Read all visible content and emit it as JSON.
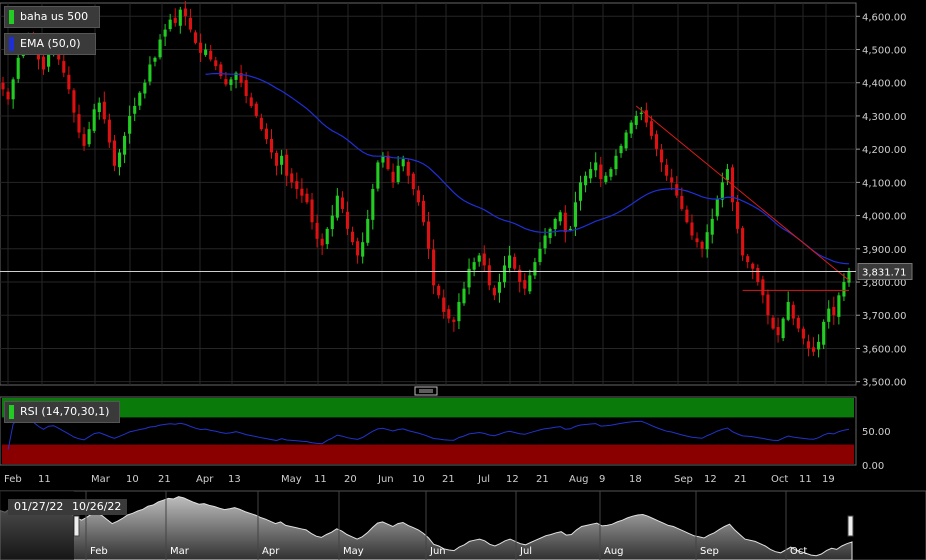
{
  "chart_data": {
    "type": "candlestick",
    "instrument": "baha us 500",
    "indicator": "EMA (50,0)",
    "last_price": "3,831.71",
    "y_ticks": [
      "4,600.00",
      "4,500.00",
      "4,400.00",
      "4,300.00",
      "4,200.00",
      "4,100.00",
      "4,000.00",
      "3,900.00",
      "3,800.00",
      "3,700.00",
      "3,600.00",
      "3,500.00"
    ],
    "ylim": [
      3490,
      4640
    ],
    "x_ticks": [
      "Feb",
      "11",
      "Mar",
      "10",
      "21",
      "Apr",
      "13",
      "May",
      "11",
      "20",
      "Jun",
      "10",
      "21",
      "Jul",
      "12",
      "21",
      "Aug",
      "9",
      "18",
      "Sep",
      "12",
      "21",
      "Oct",
      "11",
      "19"
    ],
    "closes": [
      4380,
      4350,
      4410,
      4475,
      4520,
      4540,
      4505,
      4470,
      4440,
      4490,
      4500,
      4470,
      4430,
      4380,
      4310,
      4250,
      4210,
      4260,
      4320,
      4340,
      4290,
      4220,
      4150,
      4190,
      4240,
      4300,
      4330,
      4370,
      4400,
      4455,
      4475,
      4530,
      4560,
      4590,
      4580,
      4620,
      4600,
      4560,
      4520,
      4490,
      4500,
      4470,
      4450,
      4420,
      4395,
      4410,
      4430,
      4400,
      4360,
      4330,
      4300,
      4260,
      4230,
      4190,
      4150,
      4180,
      4120,
      4100,
      4080,
      4060,
      4040,
      3980,
      3930,
      3910,
      3960,
      4000,
      4060,
      4020,
      3960,
      3920,
      3880,
      3920,
      3990,
      4080,
      4160,
      4180,
      4140,
      4100,
      4150,
      4170,
      4120,
      4080,
      4040,
      3980,
      3900,
      3790,
      3760,
      3710,
      3690,
      3680,
      3740,
      3780,
      3840,
      3860,
      3880,
      3850,
      3790,
      3760,
      3800,
      3850,
      3880,
      3840,
      3800,
      3780,
      3820,
      3860,
      3900,
      3940,
      3960,
      3990,
      4010,
      3950,
      3960,
      4040,
      4100,
      4120,
      4140,
      4160,
      4110,
      4120,
      4140,
      4180,
      4210,
      4250,
      4280,
      4300,
      4310,
      4280,
      4240,
      4200,
      4160,
      4120,
      4100,
      4060,
      4020,
      3980,
      3940,
      3920,
      3900,
      3950,
      3990,
      4050,
      4100,
      4140,
      4040,
      3960,
      3880,
      3860,
      3840,
      3800,
      3760,
      3700,
      3660,
      3640,
      3690,
      3740,
      3690,
      3660,
      3630,
      3600,
      3590,
      3620,
      3680,
      3720,
      3700,
      3760,
      3800,
      3831.71
    ],
    "ema_range": [
      4460,
      3800
    ],
    "trendline": [
      [
        4330,
        3805
      ]
    ],
    "hlines": [
      3831.71,
      3775
    ],
    "rsi": {
      "label": "RSI (14,70,30,1)",
      "overbought": 70,
      "oversold": 30,
      "y_ticks": [
        "50.00",
        "0.00"
      ]
    },
    "navigator": {
      "start": "01/27/22",
      "end": "10/26/22",
      "months": [
        "Feb",
        "Mar",
        "Apr",
        "May",
        "Jun",
        "Jul",
        "Aug",
        "Sep",
        "Oct"
      ]
    },
    "colors": {
      "up": "#22cc22",
      "down": "#dd1111",
      "ema": "#1f2fd6",
      "trend": "#d91a1a",
      "rsi_line": "#2233cc"
    }
  }
}
